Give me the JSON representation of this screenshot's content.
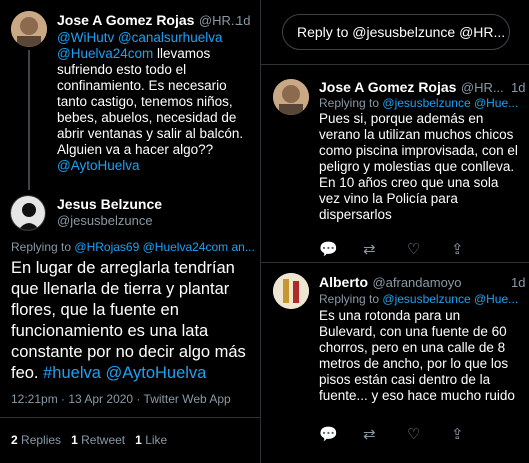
{
  "search": {
    "text": "Reply to @jesusbelzunce @HR..."
  },
  "tweet1": {
    "name": "Jose A Gomez Rojas",
    "handle": "@HR...",
    "time": "1d",
    "mentions": "@WiHutv @canalsurhuelva @Huelva24com",
    "text_after": "llevamos sufriendo esto todo el confinamiento. Es necesario tanto castigo, tenemos niños, bebes, abuelos, necesidad de abrir ventanas y salir al balcón. Alguien va a hacer algo??",
    "end_mention": "@AytoHuelva"
  },
  "tweet2": {
    "name": "Jesus Belzunce",
    "handle": "@jesusbelzunce",
    "replying_prefix": "Replying to",
    "replying_to": "@HRojas69 @Huelva24com an...",
    "text_main": "En lugar de arreglarla tendrían que llenarla de tierra y plantar flores, que la fuente en funcionamiento es una lata constante por no decir algo más feo.",
    "hashtag": "#huelva",
    "mention": "@AytoHuelva",
    "meta": "12:21pm · 13 Apr 2020 · Twitter Web App",
    "replies_count": "2",
    "replies_label": "Replies",
    "retweets_count": "1",
    "retweets_label": "Retweet",
    "likes_count": "1",
    "likes_label": "Like"
  },
  "tweet3": {
    "name": "Jose A Gomez Rojas",
    "handle": "@HR...",
    "time": "1d",
    "replying_prefix": "Replying to",
    "replying_to": "@jesusbelzunce @Hue...",
    "text1": "Pues si, porque además en verano la utilizan muchos chicos como piscina improvisada, con el peligro y molestias que conlleva.",
    "text2": "En 10 años creo que una  sola vez vino la Policía para dispersarlos"
  },
  "tweet4": {
    "name": "Alberto",
    "handle": "@afrandamoyo",
    "time": "1d",
    "replying_prefix": "Replying to",
    "replying_to": "@jesusbelzunce @Hue...",
    "text": "Es una rotonda para un Bulevard, con una fuente de 60 chorros, pero en una calle de 8 metros de ancho, por lo que los pisos están casi dentro de la fuente... y eso hace mucho ruido"
  },
  "icons": {
    "reply": "💬",
    "retweet": "⇄",
    "like": "♡",
    "share": "⇪"
  },
  "colors": {
    "accent": "#1da1f2",
    "background": "#000000",
    "muted": "#8899a6"
  }
}
